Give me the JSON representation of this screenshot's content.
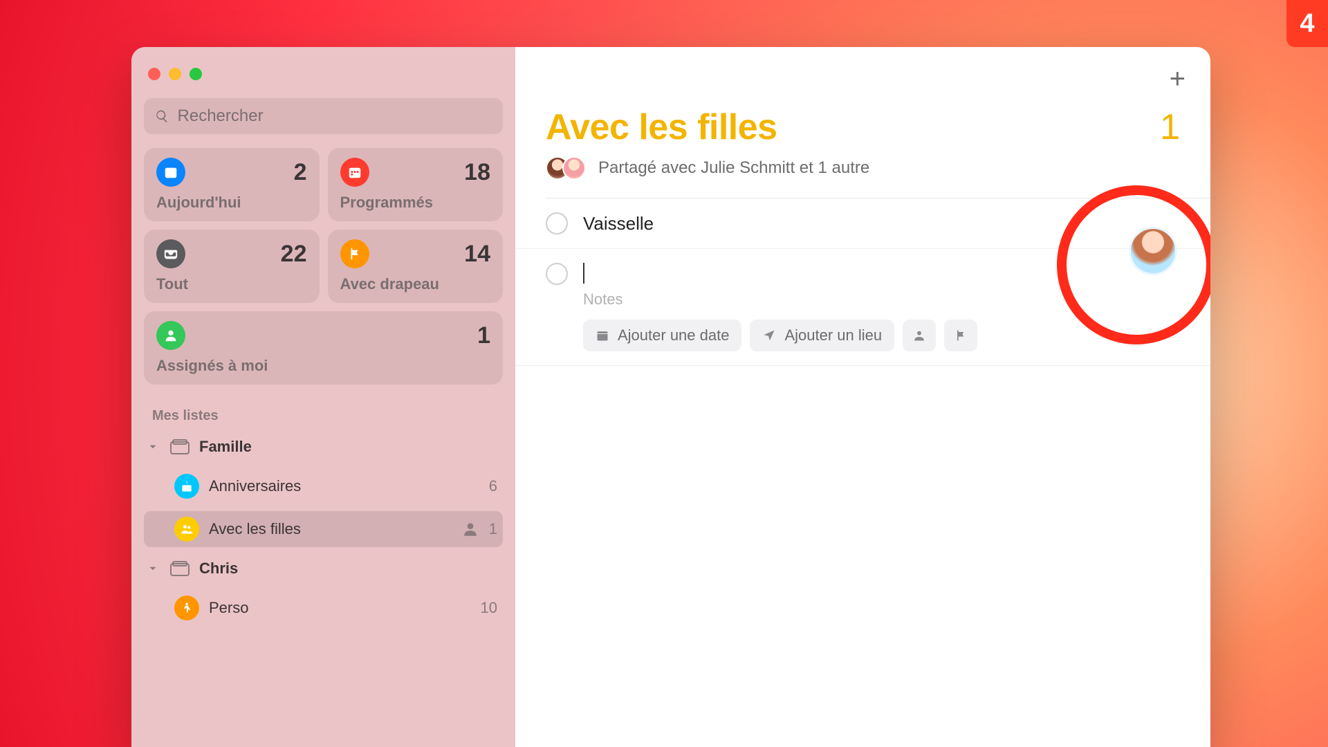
{
  "corner_badge": "4",
  "search": {
    "placeholder": "Rechercher"
  },
  "tiles": {
    "today": {
      "label": "Aujourd'hui",
      "count": "2"
    },
    "scheduled": {
      "label": "Programmés",
      "count": "18"
    },
    "all": {
      "label": "Tout",
      "count": "22"
    },
    "flagged": {
      "label": "Avec drapeau",
      "count": "14"
    },
    "assigned": {
      "label": "Assignés à moi",
      "count": "1"
    }
  },
  "sidebar": {
    "section_title": "Mes listes",
    "groups": [
      {
        "name": "Famille",
        "lists": [
          {
            "name": "Anniversaires",
            "count": "6",
            "icon": "cake",
            "color": "icon-bluecircle",
            "shared": false
          },
          {
            "name": "Avec les filles",
            "count": "1",
            "icon": "people",
            "color": "icon-yellow",
            "shared": true,
            "active": true
          }
        ]
      },
      {
        "name": "Chris",
        "lists": [
          {
            "name": "Perso",
            "count": "10",
            "icon": "walk",
            "color": "icon-orange",
            "shared": false
          }
        ]
      }
    ]
  },
  "main": {
    "title": "Avec les filles",
    "count": "1",
    "shared_text": "Partagé avec Julie Schmitt et 1 autre",
    "notes_hint": "Notes",
    "add_date": "Ajouter une date",
    "add_place": "Ajouter un lieu",
    "reminders": [
      {
        "title": "Vaisselle"
      }
    ]
  }
}
